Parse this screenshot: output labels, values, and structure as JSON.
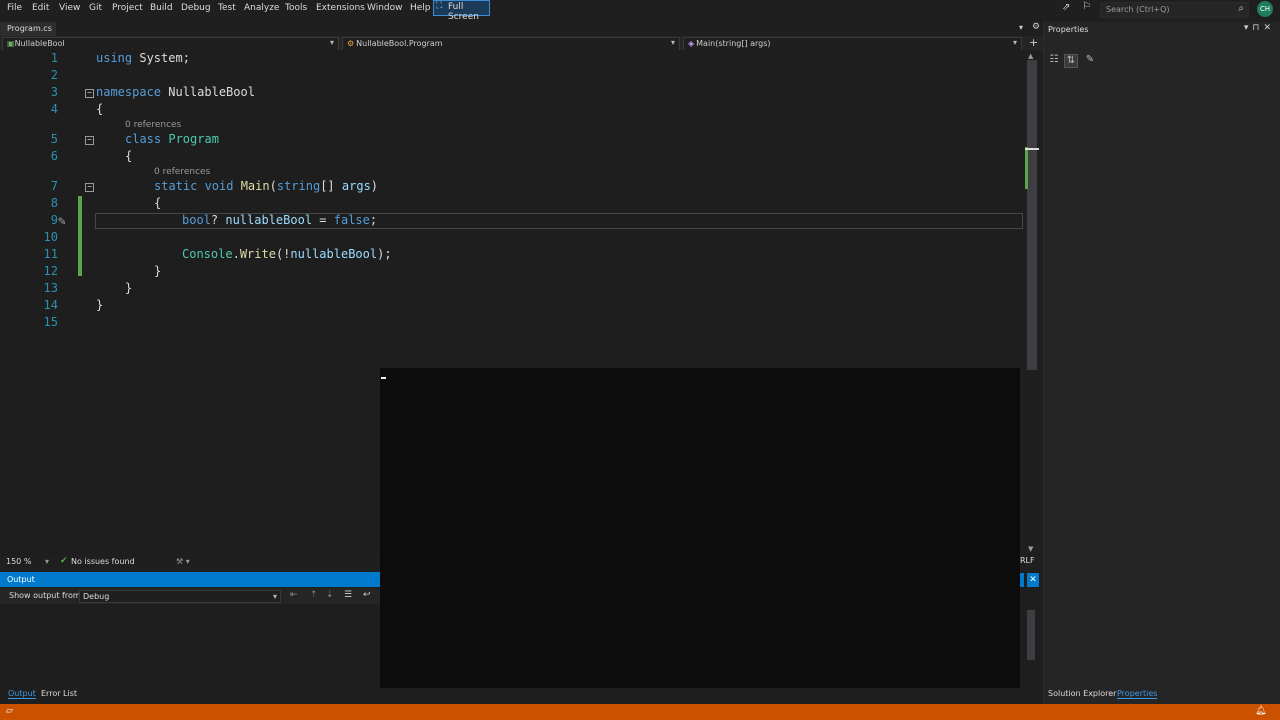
{
  "menu": [
    "File",
    "Edit",
    "View",
    "Git",
    "Project",
    "Build",
    "Debug",
    "Test",
    "Analyze",
    "Tools",
    "Extensions",
    "Window",
    "Help"
  ],
  "fullscreen_label": "Full Screen",
  "search": {
    "placeholder": "Search (Ctrl+Q)"
  },
  "avatar_initials": "CH",
  "tab": {
    "label": "Program.cs"
  },
  "nav": {
    "project": "NullableBool",
    "class": "NullableBool.Program",
    "member": "Main(string[] args)"
  },
  "code": {
    "line_numbers": [
      "1",
      "2",
      "3",
      "4",
      "5",
      "6",
      "7",
      "8",
      "9",
      "10",
      "11",
      "12",
      "13",
      "14",
      "15"
    ],
    "l1_kw": "using",
    "l1_rest": " System;",
    "l3_kw": "namespace",
    "l3_name": " NullableBool",
    "l4": "{",
    "ref_class": "0 references",
    "l5_kw": "class",
    "l5_name": " Program",
    "l6": "{",
    "ref_main": "0 references",
    "l7_kw1": "static",
    "l7_kw2": " void",
    "l7_fn": " Main",
    "l7_p1": "(",
    "l7_kw3": "string",
    "l7_p2": "[] ",
    "l7_arg": "args",
    "l7_p3": ")",
    "l8": "{",
    "l9_kw": "bool",
    "l9_q": "? ",
    "l9_var": "nullableBool",
    "l9_eq": " = ",
    "l9_val": "false",
    "l9_end": ";",
    "l11_ty": "Console",
    "l11_dot": ".",
    "l11_fn": "Write",
    "l11_p1": "(!",
    "l11_var": "nullableBool",
    "l11_p2": ");",
    "l12": "}",
    "l13": "}",
    "l14": "}"
  },
  "editor_status": {
    "zoom": "150 %",
    "issues": "No issues found"
  },
  "line_ending": "RLF",
  "output": {
    "title": "Output",
    "show_from_label": "Show output from:",
    "source": "Debug"
  },
  "bottom_tabs": [
    "Output",
    "Error List"
  ],
  "properties": {
    "title": "Properties",
    "tabs": [
      "Solution Explorer",
      "Properties"
    ]
  },
  "colors": {
    "accent": "#007acc",
    "status_bar": "#ca5100",
    "console_bg": "#0c0c0c"
  }
}
